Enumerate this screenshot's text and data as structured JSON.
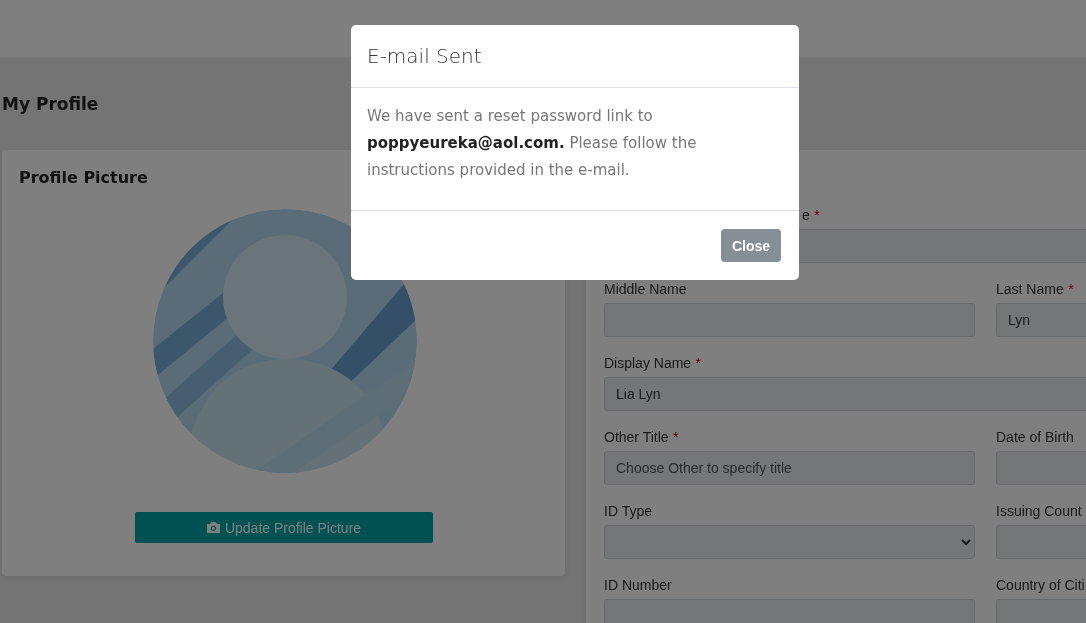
{
  "page_title": "My Profile",
  "profile_card": {
    "title": "Profile Picture",
    "button": "Update Profile Picture"
  },
  "form": {
    "rows": [
      [
        {
          "label": "e",
          "required_mark": "*",
          "kind": "text"
        }
      ],
      [
        {
          "label": "Middle Name",
          "kind": "text"
        },
        {
          "label": "Last Name",
          "required_mark": "*",
          "kind": "text",
          "value": "Lyn"
        }
      ],
      [
        {
          "label": "Display Name",
          "required_mark": "*",
          "kind": "text",
          "value": "Lia Lyn"
        }
      ],
      [
        {
          "label": "Other Title",
          "required_mark": "*",
          "kind": "text",
          "placeholder": "Choose Other to specify title"
        },
        {
          "label": "Date of Birth",
          "kind": "text"
        }
      ],
      [
        {
          "label": "ID Type",
          "kind": "select"
        },
        {
          "label": "Issuing Count",
          "kind": "text"
        }
      ],
      [
        {
          "label": "ID Number",
          "kind": "text"
        },
        {
          "label": "Country of Citi",
          "kind": "text"
        }
      ]
    ]
  },
  "modal": {
    "title": "E-mail Sent",
    "message": "We have sent a reset password link to **poppyeureka@aol.com.** Please follow the instructions provided in the e-mail.",
    "button": "Close"
  }
}
